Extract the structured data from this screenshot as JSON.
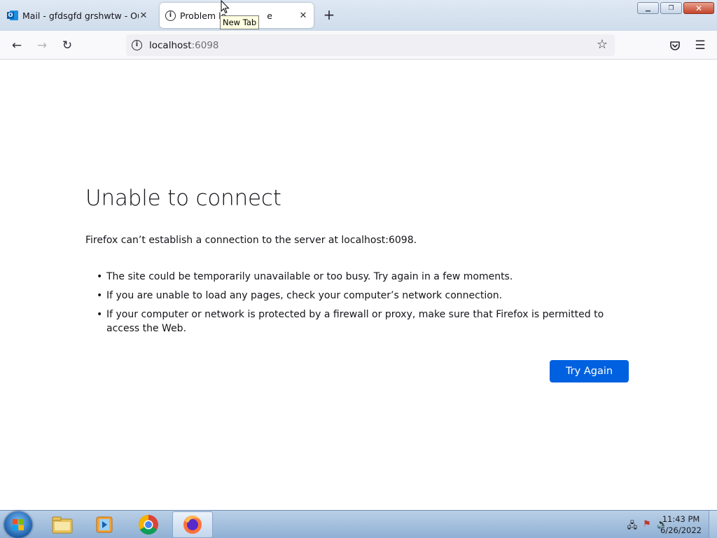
{
  "browser": {
    "tabs": [
      {
        "label": "Mail - gfdsgfd grshwtw - Outlo",
        "icon": "outlook-icon",
        "active": false
      },
      {
        "label": "Problem lo",
        "label_tail": "e",
        "icon": "info-icon",
        "active": true
      }
    ],
    "tooltip": "New Tab",
    "new_tab": "+",
    "close_glyph": "✕",
    "window_controls": {
      "minimize": "▁",
      "restore": "❐",
      "close": "✕"
    },
    "nav": {
      "back": "←",
      "forward": "→",
      "reload": "↻",
      "star": "☆",
      "pocket": "pocket-icon",
      "menu": "☰"
    },
    "url": {
      "host": "localhost",
      "port": ":6098"
    }
  },
  "error_page": {
    "title": "Unable to connect",
    "description": "Firefox can’t establish a connection to the server at localhost:6098.",
    "bullets": [
      "The site could be temporarily unavailable or too busy. Try again in a few moments.",
      "If you are unable to load any pages, check your computer’s network connection.",
      "If your computer or network is protected by a firewall or proxy, make sure that Firefox is permitted to access the Web."
    ],
    "try_again": "Try Again",
    "accent_color": "#0061e0"
  },
  "taskbar": {
    "items": [
      "windows-explorer-icon",
      "media-player-icon",
      "chrome-icon",
      "firefox-icon"
    ],
    "clock": {
      "time": "11:43 PM",
      "date": "6/26/2022"
    },
    "tray_icons": [
      "network-icon",
      "action-center-icon",
      "volume-icon"
    ]
  }
}
